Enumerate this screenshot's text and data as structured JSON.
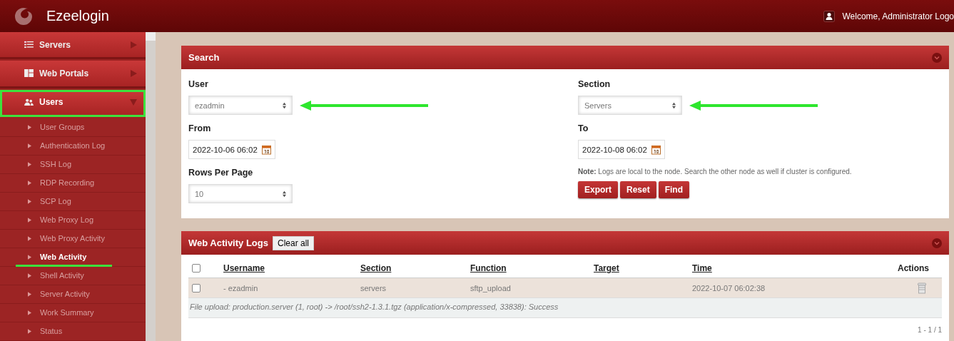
{
  "header": {
    "brand": "Ezeelogin",
    "welcome": "Welcome, Administrator Logo"
  },
  "sidebar": {
    "items": [
      {
        "label": "Servers",
        "expanded": false,
        "highlighted": false
      },
      {
        "label": "Web Portals",
        "expanded": false,
        "highlighted": false
      },
      {
        "label": "Users",
        "expanded": true,
        "highlighted": true,
        "children": [
          {
            "label": "User Groups",
            "selected": false,
            "underlined": false
          },
          {
            "label": "Authentication Log",
            "selected": false,
            "underlined": false
          },
          {
            "label": "SSH Log",
            "selected": false,
            "underlined": false
          },
          {
            "label": "RDP Recording",
            "selected": false,
            "underlined": false
          },
          {
            "label": "SCP Log",
            "selected": false,
            "underlined": false
          },
          {
            "label": "Web Proxy Log",
            "selected": false,
            "underlined": false
          },
          {
            "label": "Web Proxy Activity",
            "selected": false,
            "underlined": false
          },
          {
            "label": "Web Activity",
            "selected": true,
            "underlined": true
          },
          {
            "label": "Shell Activity",
            "selected": false,
            "underlined": false
          },
          {
            "label": "Server Activity",
            "selected": false,
            "underlined": false
          },
          {
            "label": "Work Summary",
            "selected": false,
            "underlined": false
          },
          {
            "label": "Status",
            "selected": false,
            "underlined": false
          }
        ]
      }
    ]
  },
  "search": {
    "title": "Search",
    "left": [
      {
        "label": "User",
        "kind": "select",
        "value": "ezadmin",
        "arrow": true
      },
      {
        "label": "From",
        "kind": "date",
        "value": "2022-10-06 06:02",
        "arrow": false
      },
      {
        "label": "Rows Per Page",
        "kind": "select",
        "value": "10",
        "arrow": false
      }
    ],
    "right": [
      {
        "label": "Section",
        "kind": "select",
        "value": "Servers",
        "arrow": true
      },
      {
        "label": "To",
        "kind": "date",
        "value": "2022-10-08 06:02",
        "arrow": false
      }
    ],
    "note": "**Note:** Logs are local to the node. Search the other node as well if cluster is configured.",
    "buttons": [
      "Export",
      "Reset",
      "Find"
    ]
  },
  "logs": {
    "title": "Web Activity Logs",
    "clear_button": "Clear all",
    "columns": [
      "Username",
      "Section",
      "Function",
      "Target",
      "Time",
      "Actions"
    ],
    "rows": [
      {
        "checked": false,
        "username": "- ezadmin",
        "section": "servers",
        "function": "sftp_upload",
        "time": "2022-10-07 06:02:38",
        "detail": "File upload: production.server (1, root) -> /root/ssh2-1.3.1.tgz (application/x-compressed, 33838): Success"
      }
    ],
    "select_all": false,
    "pagination": "1 - 1 / 1"
  }
}
